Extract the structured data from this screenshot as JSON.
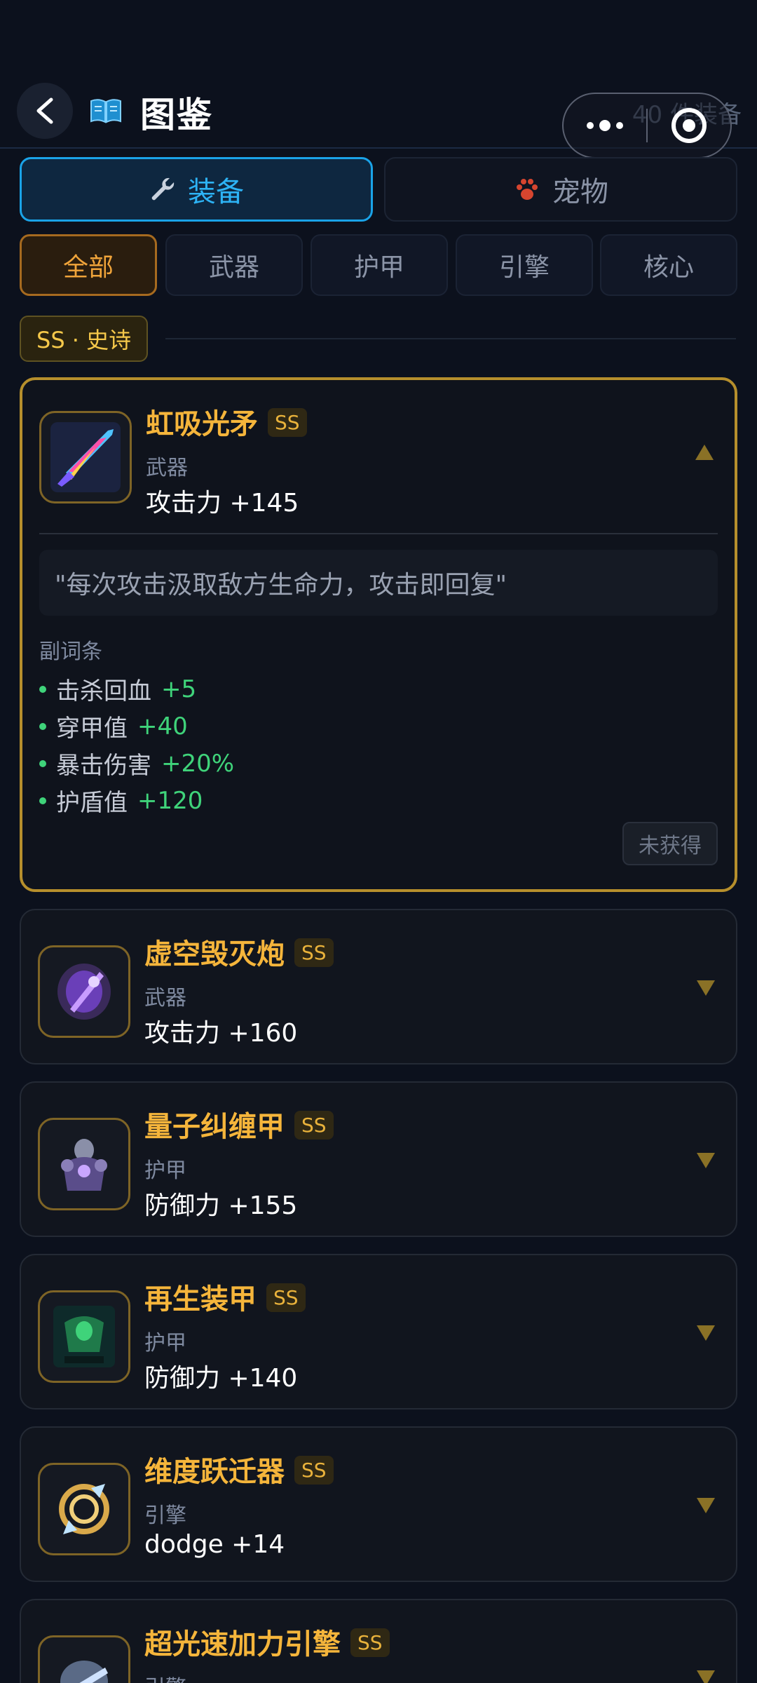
{
  "header": {
    "title": "图鉴",
    "count": "40 件装备",
    "back_icon": "back-arrow-icon",
    "title_icon": "book-icon"
  },
  "main_tabs": [
    {
      "label": "装备",
      "icon": "wrench-icon",
      "active": true
    },
    {
      "label": "宠物",
      "icon": "paw-icon",
      "active": false
    }
  ],
  "sub_tabs": [
    {
      "label": "全部",
      "active": true
    },
    {
      "label": "武器",
      "active": false
    },
    {
      "label": "护甲",
      "active": false
    },
    {
      "label": "引擎",
      "active": false
    },
    {
      "label": "核心",
      "active": false
    }
  ],
  "section": {
    "label": "SS · 史诗"
  },
  "cards": [
    {
      "name": "虹吸光矛",
      "grade": "SS",
      "type": "武器",
      "stat": "攻击力 +145",
      "expanded": true,
      "quote": "\"每次攻击汲取敌方生命力，攻击即回复\"",
      "affix_title": "副词条",
      "affixes": [
        {
          "name": "击杀回血",
          "value": "+5"
        },
        {
          "name": "穿甲值",
          "value": "+40"
        },
        {
          "name": "暴击伤害",
          "value": "+20%"
        },
        {
          "name": "护盾值",
          "value": "+120"
        }
      ],
      "status": "未获得"
    },
    {
      "name": "虚空毁灭炮",
      "grade": "SS",
      "type": "武器",
      "stat": "攻击力 +160",
      "expanded": false
    },
    {
      "name": "量子纠缠甲",
      "grade": "SS",
      "type": "护甲",
      "stat": "防御力 +155",
      "expanded": false
    },
    {
      "name": "再生装甲",
      "grade": "SS",
      "type": "护甲",
      "stat": "防御力 +140",
      "expanded": false
    },
    {
      "name": "维度跃迁器",
      "grade": "SS",
      "type": "引擎",
      "stat": "dodge +14",
      "expanded": false
    },
    {
      "name": "超光速加力引擎",
      "grade": "SS",
      "type": "引擎",
      "stat": "",
      "expanded": false
    }
  ],
  "colors": {
    "accent_blue": "#2db3f5",
    "accent_orange": "#f0a43a",
    "gold": "#f5b53b",
    "green": "#3fd37a",
    "background": "#0c111d"
  }
}
